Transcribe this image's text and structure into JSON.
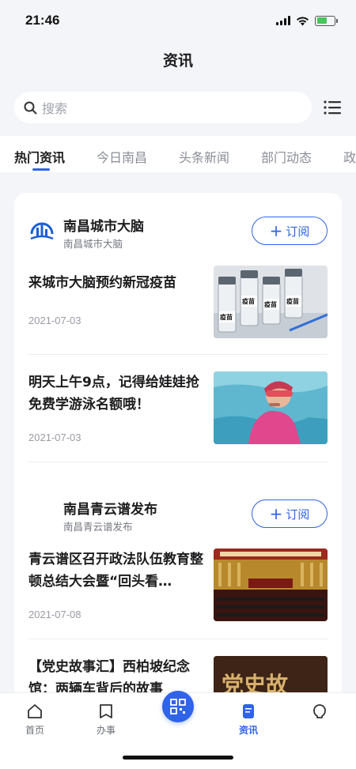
{
  "status_bar": {
    "time": "21:46"
  },
  "header": {
    "title": "资讯"
  },
  "search": {
    "placeholder": "搜索"
  },
  "tabs": [
    {
      "label": "热门资讯",
      "active": true
    },
    {
      "label": "今日南昌",
      "active": false
    },
    {
      "label": "头条新闻",
      "active": false
    },
    {
      "label": "部门动态",
      "active": false
    },
    {
      "label": "政",
      "active": false
    }
  ],
  "sources": [
    {
      "name": "南昌城市大脑",
      "subtitle": "南昌城市大脑",
      "subscribe_label": "订阅",
      "articles": [
        {
          "title": "来城市大脑预约新冠疫苗",
          "date": "2021-07-03",
          "thumb_labels": [
            "疫苗",
            "疫苗",
            "疫苗",
            "疫苗"
          ]
        },
        {
          "title": "明天上午9点，记得给娃娃抢免费学游泳名额哦！",
          "date": "2021-07-03"
        }
      ]
    },
    {
      "name": "南昌青云谱发布",
      "subtitle": "南昌青云谱发布",
      "subscribe_label": "订阅",
      "articles": [
        {
          "title": "青云谱区召开政法队伍教育整顿总结大会暨“回头看…",
          "date": "2021-07-08"
        },
        {
          "title": "【党史故事汇】西柏坡纪念馆：两辆车背后的故事",
          "date": "",
          "thumb_text": "党史故"
        }
      ]
    }
  ],
  "bottom_nav": {
    "items": [
      {
        "label": "首页",
        "icon": "home-icon"
      },
      {
        "label": "办事",
        "icon": "book-icon"
      },
      {
        "label": "",
        "icon": "qr-scan-icon"
      },
      {
        "label": "资讯",
        "icon": "news-icon",
        "active": true
      },
      {
        "label": "",
        "icon": "user-icon"
      }
    ]
  },
  "colors": {
    "accent": "#2f63e8",
    "background": "#f4f5f8"
  }
}
